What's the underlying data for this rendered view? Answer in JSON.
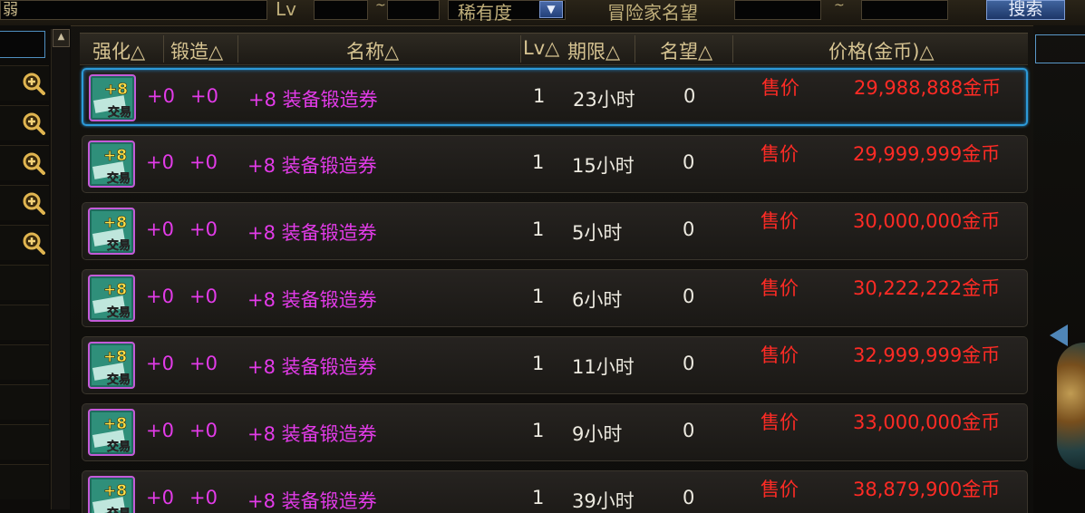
{
  "topbar": {
    "left_fragment": "弱",
    "lv_label": "Lv",
    "lv_min": "",
    "lv_sep": "~",
    "lv_max": "",
    "rarity_label": "稀有度",
    "renown_label": "冒险家名望",
    "renown_min": "",
    "renown_sep": "~",
    "renown_max": "",
    "search_label": "搜索"
  },
  "icons": {
    "zoom": "magnifier-plus-icon",
    "scroll_up": "chevron-up-icon",
    "dropdown": "triangle-down-icon",
    "item": "plus8-forge-ticket-icon"
  },
  "table": {
    "headers": [
      "强化△",
      "锻造△",
      "名称△",
      "Lv△",
      "期限△",
      "名望△",
      "价格(金币)△"
    ],
    "rows": [
      {
        "enhance": "+0",
        "forge": "+0",
        "name": "+8 装备锻造券",
        "lv": "1",
        "duration": "23小时",
        "renown": "0",
        "sale_label": "售价",
        "price": "29,988,888金币",
        "selected": true
      },
      {
        "enhance": "+0",
        "forge": "+0",
        "name": "+8 装备锻造券",
        "lv": "1",
        "duration": "15小时",
        "renown": "0",
        "sale_label": "售价",
        "price": "29,999,999金币",
        "selected": false
      },
      {
        "enhance": "+0",
        "forge": "+0",
        "name": "+8 装备锻造券",
        "lv": "1",
        "duration": "5小时",
        "renown": "0",
        "sale_label": "售价",
        "price": "30,000,000金币",
        "selected": false
      },
      {
        "enhance": "+0",
        "forge": "+0",
        "name": "+8 装备锻造券",
        "lv": "1",
        "duration": "6小时",
        "renown": "0",
        "sale_label": "售价",
        "price": "30,222,222金币",
        "selected": false
      },
      {
        "enhance": "+0",
        "forge": "+0",
        "name": "+8 装备锻造券",
        "lv": "1",
        "duration": "11小时",
        "renown": "0",
        "sale_label": "售价",
        "price": "32,999,999金币",
        "selected": false
      },
      {
        "enhance": "+0",
        "forge": "+0",
        "name": "+8 装备锻造券",
        "lv": "1",
        "duration": "9小时",
        "renown": "0",
        "sale_label": "售价",
        "price": "33,000,000金币",
        "selected": false
      },
      {
        "enhance": "+0",
        "forge": "+0",
        "name": "+8 装备锻造券",
        "lv": "1",
        "duration": "39小时",
        "renown": "0",
        "sale_label": "售价",
        "price": "38,879,900金币",
        "selected": false
      }
    ]
  },
  "item_icon_text": {
    "top": "+8",
    "bottom": "交易"
  },
  "colors": {
    "accent_blue": "#2d9ad8",
    "name_magenta": "#e23be8",
    "price_red": "#ff2b25",
    "header_gold": "#d6c391"
  }
}
